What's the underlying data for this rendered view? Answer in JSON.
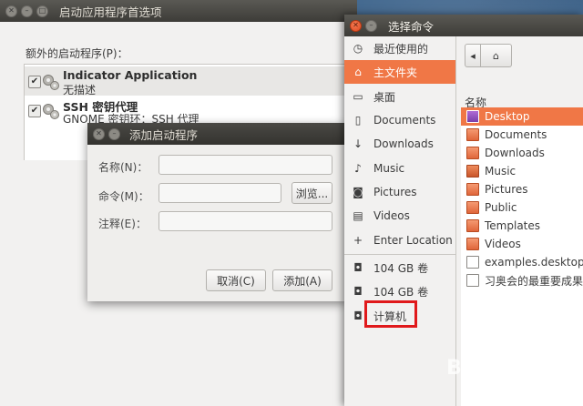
{
  "startup_window": {
    "title": "启动应用程序首选项",
    "section_label": "额外的启动程序(P)：",
    "programs": [
      {
        "name": "Indicator Application",
        "desc": "无描述",
        "checked": true
      },
      {
        "name": "SSH 密钥代理",
        "desc": "GNOME 密钥环：SSH 代理",
        "checked": true
      }
    ]
  },
  "add_dialog": {
    "title": "添加启动程序",
    "name_label": "名称(N)：",
    "command_label": "命令(M)：",
    "comment_label": "注释(E)：",
    "name_value": "",
    "command_value": "",
    "comment_value": "",
    "browse_label": "浏览...",
    "cancel_label": "取消(C)",
    "add_label": "添加(A)"
  },
  "chooser": {
    "title": "选择命令",
    "places": [
      {
        "label": "最近使用的",
        "icon": "clock-icon"
      },
      {
        "label": "主文件夹",
        "icon": "home-icon",
        "selected": true
      },
      {
        "label": "桌面",
        "icon": "desktop-icon"
      },
      {
        "label": "Documents",
        "icon": "document-icon"
      },
      {
        "label": "Downloads",
        "icon": "download-icon"
      },
      {
        "label": "Music",
        "icon": "music-icon"
      },
      {
        "label": "Pictures",
        "icon": "camera-icon"
      },
      {
        "label": "Videos",
        "icon": "film-icon"
      },
      {
        "label": "Enter Location",
        "icon": "plus-icon"
      }
    ],
    "devices": [
      {
        "label": "104 GB 卷",
        "icon": "drive-icon"
      },
      {
        "label": "104 GB 卷",
        "icon": "drive-icon"
      },
      {
        "label": "计算机",
        "icon": "computer-icon"
      }
    ],
    "column_header": "名称",
    "files": [
      {
        "name": "Desktop",
        "type": "folder-desk",
        "selected": true
      },
      {
        "name": "Documents",
        "type": "folder"
      },
      {
        "name": "Downloads",
        "type": "folder"
      },
      {
        "name": "Music",
        "type": "music"
      },
      {
        "name": "Pictures",
        "type": "folder"
      },
      {
        "name": "Public",
        "type": "folder"
      },
      {
        "name": "Templates",
        "type": "folder"
      },
      {
        "name": "Videos",
        "type": "folder"
      },
      {
        "name": "examples.desktop",
        "type": "doc"
      },
      {
        "name": "习奥会的最重要成果",
        "type": "doc"
      }
    ]
  },
  "watermark": "Baidu 经验",
  "colors": {
    "accent": "#f07746",
    "highlight_box": "#e0191b"
  }
}
